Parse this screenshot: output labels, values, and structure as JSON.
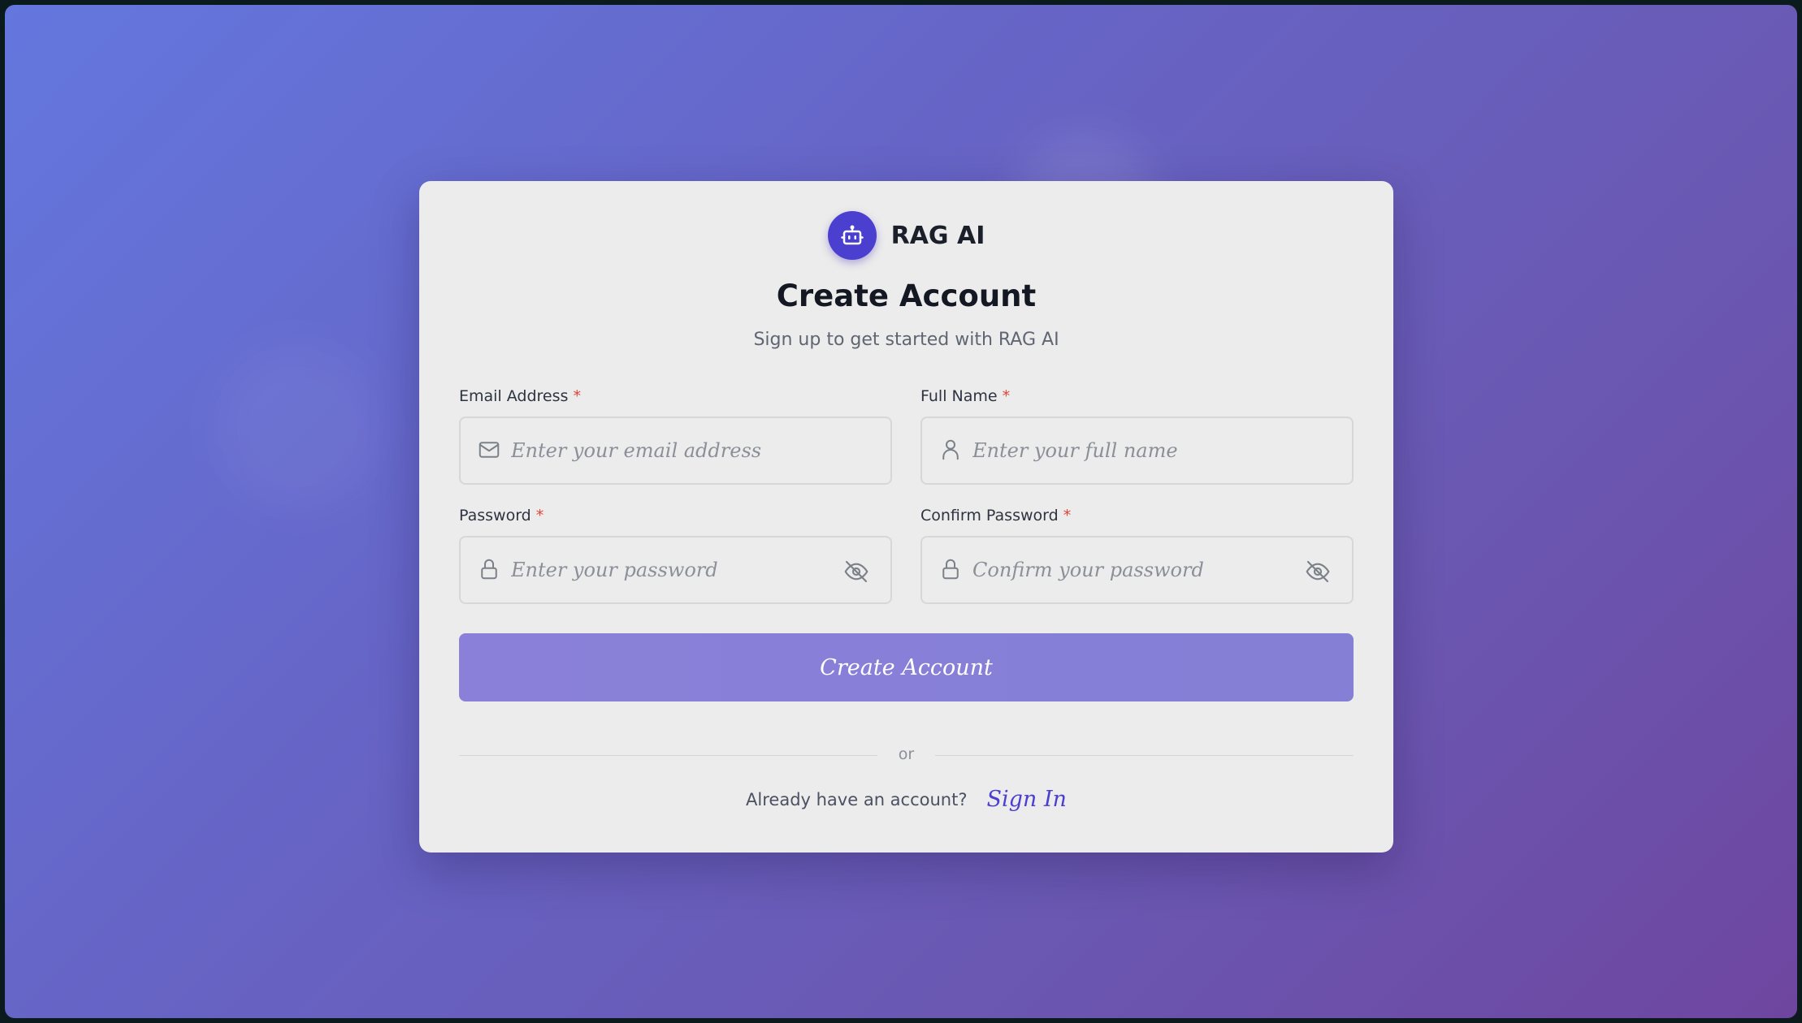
{
  "brand": {
    "name": "RAG AI",
    "icon": "robot-icon",
    "accent": "#4b3fcf"
  },
  "header": {
    "title": "Create Account",
    "subtitle": "Sign up to get started with RAG AI"
  },
  "form": {
    "email": {
      "label": "Email Address",
      "required": "*",
      "placeholder": "Enter your email address",
      "value": "",
      "icon": "mail-icon"
    },
    "full_name": {
      "label": "Full Name",
      "required": "*",
      "placeholder": "Enter your full name",
      "value": "",
      "icon": "user-icon"
    },
    "password": {
      "label": "Password",
      "required": "*",
      "placeholder": "Enter your password",
      "value": "",
      "icon": "lock-icon",
      "toggle_icon": "eye-off-icon"
    },
    "confirm_password": {
      "label": "Confirm Password",
      "required": "*",
      "placeholder": "Confirm your password",
      "value": "",
      "icon": "lock-icon",
      "toggle_icon": "eye-off-icon"
    },
    "submit_label": "Create Account"
  },
  "divider": {
    "text": "or"
  },
  "footer": {
    "prompt": "Already have an account?",
    "link_label": "Sign In"
  },
  "colors": {
    "background_start": "#6477de",
    "background_end": "#6e46a0",
    "button": "#8a80d9",
    "link": "#4a3fd0",
    "required": "#e0443a"
  }
}
